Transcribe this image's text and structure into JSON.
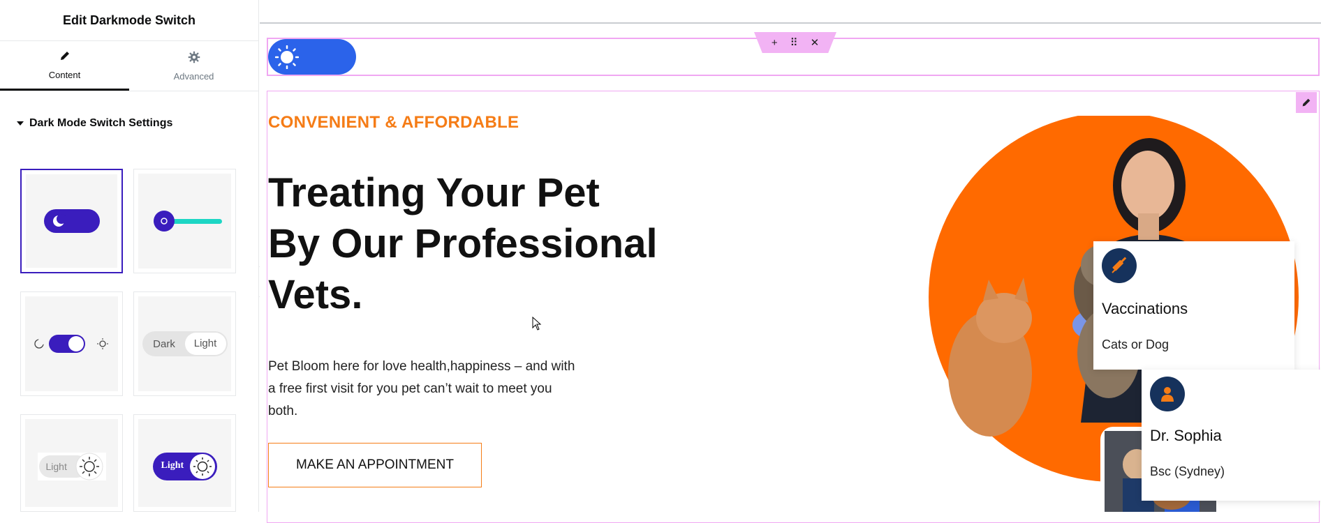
{
  "panel": {
    "title": "Edit Darkmode Switch",
    "tabs": [
      {
        "label": "Content",
        "icon": "pencil-icon",
        "active": true
      },
      {
        "label": "Advanced",
        "icon": "gear-icon",
        "active": false
      }
    ],
    "section_title": "Dark Mode Switch Settings",
    "presets": {
      "dark_label": "Dark",
      "light_label": "Light",
      "light_label_2": "Light",
      "light_label_3": "Light"
    }
  },
  "canvas": {
    "section_toolbar": {
      "add": "+",
      "drag": "⠿",
      "close": "✕"
    },
    "eyebrow": "CONVENIENT & AFFORDABLE",
    "headline_line1": "Treating Your Pet",
    "headline_line2": "By Our Professional",
    "headline_line3": "Vets.",
    "paragraph": "Pet Bloom here for love health,happiness – and with a free first visit for you pet can’t wait to meet you both.",
    "cta_label": "MAKE AN APPOINTMENT",
    "cards": [
      {
        "title": "Vaccinations",
        "subtitle": "Cats or Dog",
        "icon": "syringe-icon"
      },
      {
        "title": "Dr. Sophia",
        "subtitle": "Bsc (Sydney)",
        "icon": "doctor-icon"
      }
    ]
  },
  "colors": {
    "accent_orange": "#f57c16",
    "hero_orange": "#ff6a00",
    "switch_blue": "#2b63ea",
    "preset_purple": "#3a1dbd",
    "preset_teal": "#1dd6c4",
    "card_icon_navy": "#16325c",
    "outline_pink": "#f0a7f2"
  }
}
